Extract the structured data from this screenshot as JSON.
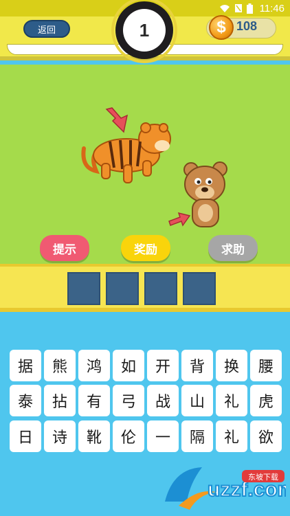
{
  "status_bar": {
    "time": "11:46"
  },
  "header": {
    "back_label": "返回",
    "level": "1",
    "coin_symbol": "$",
    "coins": "108"
  },
  "actions": {
    "hint": "提示",
    "bonus": "奖励",
    "help": "求助"
  },
  "answer_slots": [
    "",
    "",
    "",
    ""
  ],
  "tiles": [
    [
      "据",
      "熊",
      "鸿",
      "如",
      "开",
      "背",
      "换",
      "腰"
    ],
    [
      "泰",
      "拈",
      "有",
      "弓",
      "战",
      "山",
      "礼",
      "虎"
    ],
    [
      "日",
      "诗",
      "靴",
      "伦",
      "一",
      "隔",
      "礼",
      "欲"
    ]
  ],
  "watermark": {
    "site": "uzzf.com",
    "tag": "东坡下载"
  },
  "colors": {
    "sky": "#4fc6ee",
    "grass": "#a5db4b",
    "header": "#f1e84a",
    "slot": "#3b6388",
    "hint": "#f05a72",
    "bonus": "#f9d40b",
    "help": "#a6a6a6"
  }
}
